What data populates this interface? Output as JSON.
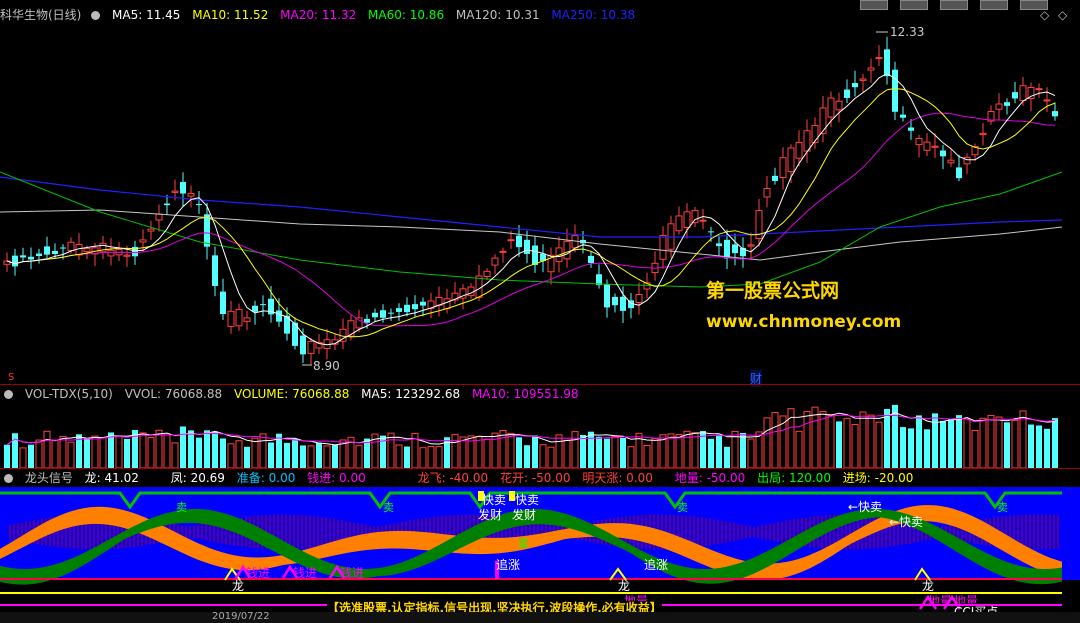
{
  "main": {
    "stock_name": "科华生物(日线)",
    "ma": [
      {
        "label": "MA5: 11.45",
        "color": "#ffffff"
      },
      {
        "label": "MA10: 11.52",
        "color": "#ffff00"
      },
      {
        "label": "MA20: 11.32",
        "color": "#ff00ff"
      },
      {
        "label": "MA60: 10.86",
        "color": "#00ff00"
      },
      {
        "label": "MA120: 10.31",
        "color": "#c0c0c0"
      },
      {
        "label": "MA250: 10.38",
        "color": "#2020ff"
      }
    ],
    "high_label": "12.33",
    "low_label": "8.90",
    "fin_mark": "财",
    "s_mark": "S"
  },
  "watermark": {
    "line1": "第一股票公式网",
    "line2": "www.chnmoney.com"
  },
  "vol": {
    "labels": [
      {
        "text": "VOL-TDX(5,10)",
        "color": "#c0c0c0"
      },
      {
        "text": "VVOL: 76068.88",
        "color": "#c0c0c0"
      },
      {
        "text": "VOLUME: 76068.88",
        "color": "#ffff00"
      },
      {
        "text": "MA5: 123292.68",
        "color": "#ffffff"
      },
      {
        "text": "MA10: 109551.98",
        "color": "#ff00ff"
      }
    ]
  },
  "signal": {
    "labels": [
      {
        "text": "龙头信号",
        "color": "#c0c0c0"
      },
      {
        "text": "龙: 41.02",
        "color": "#ffffff"
      },
      {
        "text": "凤: 20.69",
        "color": "#ffffff"
      },
      {
        "text": "准备: 0.00",
        "color": "#00c0ff"
      },
      {
        "text": "钱进: 0.00",
        "color": "#ff00ff"
      },
      {
        "text": "龙飞: -40.00",
        "color": "#ff4040"
      },
      {
        "text": "花开: -50.00",
        "color": "#ff4040"
      },
      {
        "text": "明天涨: 0.00",
        "color": "#ff4040"
      },
      {
        "text": "地量: -50.00",
        "color": "#ff00ff"
      },
      {
        "text": "出局: 120.00",
        "color": "#00ff00"
      },
      {
        "text": "进场: -20.00",
        "color": "#ffff00"
      }
    ],
    "marks": {
      "sell": "卖",
      "fast_sell": "快卖",
      "fast_sell_arrow": "←快卖",
      "get_rich": "发财",
      "chase": "追涨",
      "dragon": "龙",
      "money_in": "钱进",
      "ground": "地量",
      "cci_buy": "CCI买点"
    },
    "notice": "【选准股票,认定指标,信号出现,坚决执行,波段操作,必有收益】"
  },
  "date_label": "2019/07/22"
}
